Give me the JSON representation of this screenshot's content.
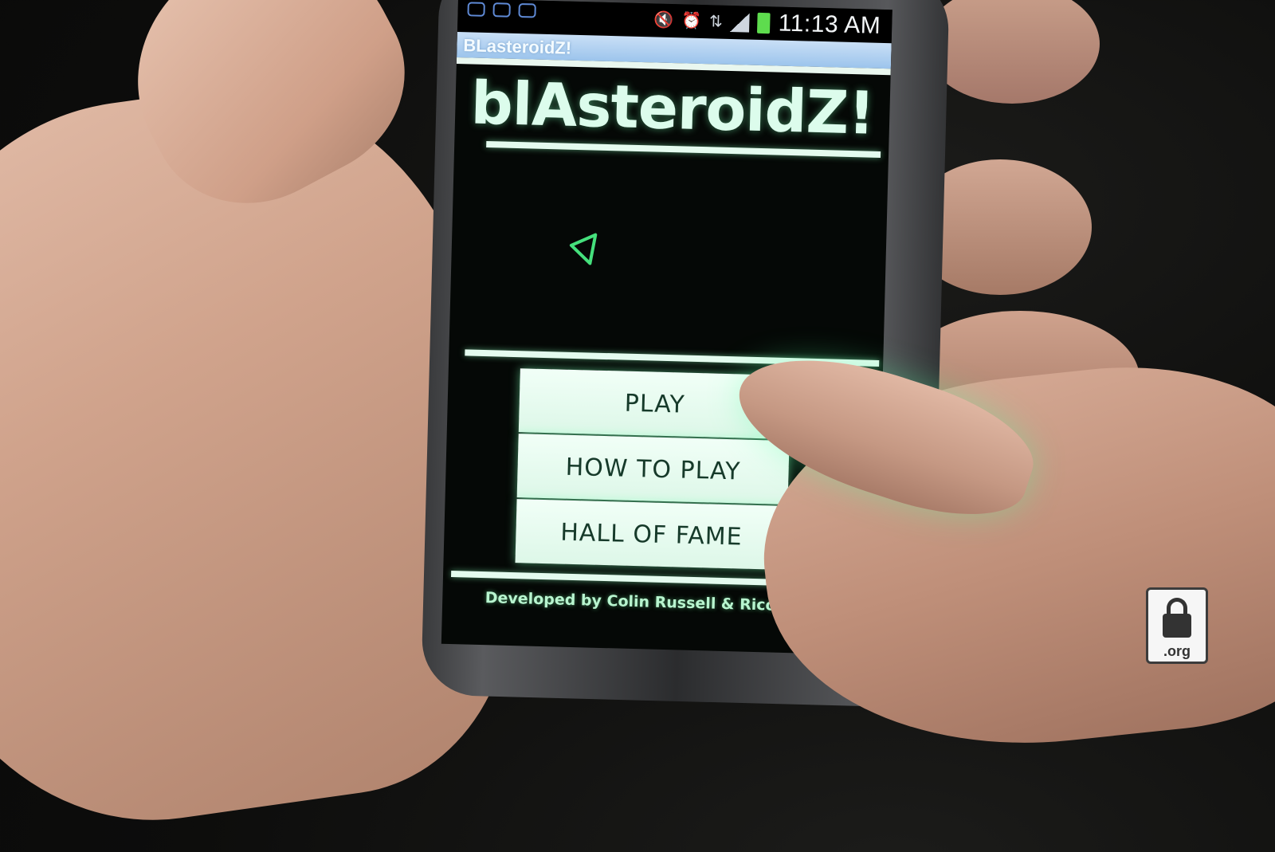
{
  "status_bar": {
    "time": "11:13 AM",
    "icons": [
      "mail-icon",
      "app-icon",
      "app-icon",
      "mute-icon",
      "alarm-icon",
      "lte-icon",
      "signal-icon",
      "battery-icon"
    ]
  },
  "app": {
    "window_title": "BLasteroidZ!",
    "game_title": "blAsteroidZ!",
    "ship_icon": "triangle-ship-icon",
    "menu": [
      {
        "label": "PLAY"
      },
      {
        "label": "HOW TO PLAY"
      },
      {
        "label": "HALL OF FAME"
      }
    ],
    "credits": "Developed by Colin Russell & Rico Jaeggi"
  },
  "colors": {
    "glow_green": "#7cffb4",
    "button_bg": "#e6fbef",
    "button_text": "#163a2a",
    "title_bar_blue": "#9cc4ec",
    "screen_bg": "#050806"
  },
  "watermark": {
    "text": ".org"
  }
}
